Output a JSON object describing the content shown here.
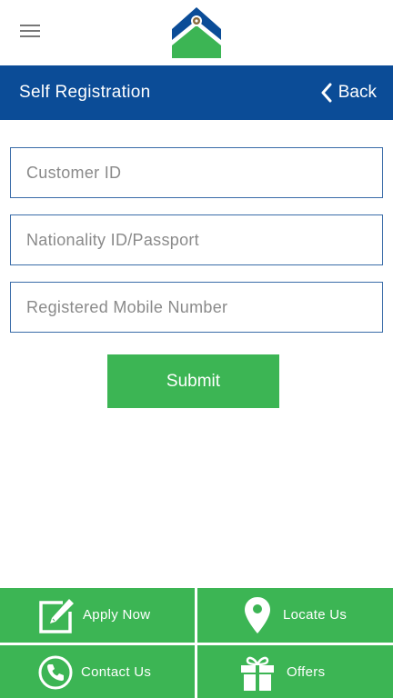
{
  "header": {
    "title": "Self Registration",
    "back_label": "Back",
    "color": "#0b4c97"
  },
  "logo_icon": "house-logo-icon",
  "form": {
    "customer_id": {
      "placeholder": "Customer ID",
      "value": ""
    },
    "nationality_id": {
      "placeholder": "Nationality ID/Passport",
      "value": ""
    },
    "mobile": {
      "placeholder": "Registered Mobile Number",
      "value": ""
    },
    "submit_label": "Submit",
    "accent": "#3cb554"
  },
  "bottom_nav": [
    {
      "label": "Apply Now",
      "icon": "edit-icon"
    },
    {
      "label": "Locate Us",
      "icon": "location-pin-icon"
    },
    {
      "label": "Contact Us",
      "icon": "phone-icon"
    },
    {
      "label": "Offers",
      "icon": "gift-icon"
    }
  ]
}
